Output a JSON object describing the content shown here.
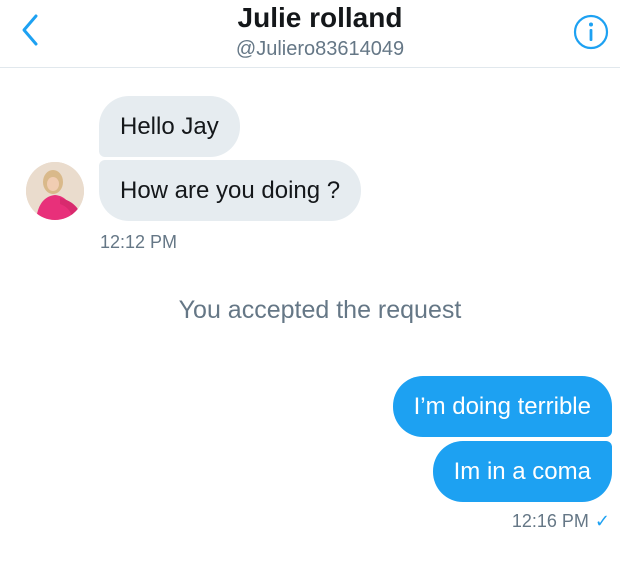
{
  "header": {
    "title": "Julie rolland",
    "handle": "@Juliero83614049"
  },
  "conversation": {
    "incoming": [
      {
        "text": "Hello  Jay"
      },
      {
        "text": "How are you doing ?"
      }
    ],
    "incoming_time": "12:12 PM",
    "system_message": "You accepted the request",
    "outgoing": [
      {
        "text": "I’m doing terrible"
      },
      {
        "text": "Im in a coma"
      }
    ],
    "outgoing_time": "12:16 PM"
  },
  "colors": {
    "accent": "#1da1f2",
    "incoming_bubble": "#e6ecf0",
    "secondary_text": "#657786"
  },
  "icons": {
    "back": "chevron-left-icon",
    "info": "info-icon",
    "read_receipt": "checkmark-icon"
  }
}
